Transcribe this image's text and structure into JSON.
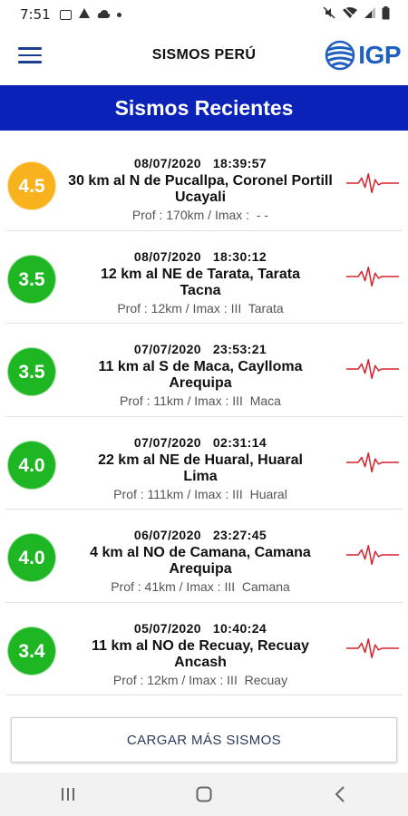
{
  "status_bar": {
    "time": "7:51",
    "left_icons": [
      "image-icon",
      "warning-icon",
      "cloud-icon",
      "dot-icon"
    ],
    "right_icons": [
      "mute-icon",
      "wifi-icon",
      "signal-icon",
      "battery-icon"
    ]
  },
  "app_bar": {
    "title": "SISMOS PERÚ",
    "logo_text": "IGP",
    "menu_icon": "hamburger-menu-icon"
  },
  "banner": {
    "title": "Sismos Recientes"
  },
  "colors": {
    "banner": "#0a22b8",
    "mag_yellow": "#f7b21e",
    "mag_green": "#1fb623",
    "wave": "#d9202a",
    "logo": "#1f5fbf"
  },
  "earthquakes": [
    {
      "magnitude": "4.5",
      "level": "yellow",
      "datetime": "08/07/2020   18:39:57",
      "location": "30 km al N de Pucallpa, Coronel Portill",
      "region": "Ucayali",
      "details": "Prof : 170km / Imax :  - -"
    },
    {
      "magnitude": "3.5",
      "level": "green",
      "datetime": "08/07/2020   18:30:12",
      "location": "12 km al NE de Tarata, Tarata",
      "region": "Tacna",
      "details": "Prof : 12km / Imax : III  Tarata"
    },
    {
      "magnitude": "3.5",
      "level": "green",
      "datetime": "07/07/2020   23:53:21",
      "location": "11 km al S de Maca, Caylloma",
      "region": "Arequipa",
      "details": "Prof : 11km / Imax : III  Maca"
    },
    {
      "magnitude": "4.0",
      "level": "green",
      "datetime": "07/07/2020   02:31:14",
      "location": "22 km al NE de Huaral, Huaral",
      "region": "Lima",
      "details": "Prof : 111km / Imax : III  Huaral"
    },
    {
      "magnitude": "4.0",
      "level": "green",
      "datetime": "06/07/2020   23:27:45",
      "location": "4 km al NO de Camana, Camana",
      "region": "Arequipa",
      "details": "Prof : 41km / Imax : III  Camana"
    },
    {
      "magnitude": "3.4",
      "level": "green",
      "datetime": "05/07/2020   10:40:24",
      "location": "11 km al NO de Recuay, Recuay",
      "region": "Ancash",
      "details": "Prof : 12km / Imax : III  Recuay"
    }
  ],
  "load_more": {
    "label": "CARGAR MÁS SISMOS"
  },
  "nav_bar": {
    "buttons": [
      "recent-apps-icon",
      "home-icon",
      "back-icon"
    ]
  }
}
